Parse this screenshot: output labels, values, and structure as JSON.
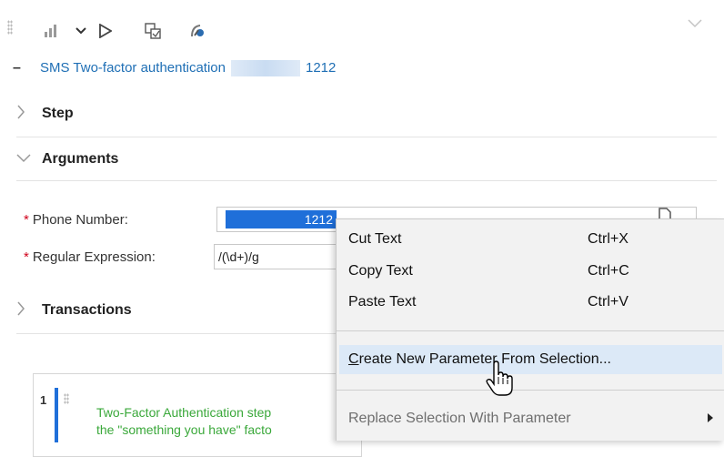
{
  "toolbar": {
    "icons": [
      "bar-chart-icon",
      "chevron-down-icon",
      "play-icon",
      "compare-icon",
      "record-icon"
    ]
  },
  "step_title": {
    "prefix": "SMS Two-factor authentication",
    "suffix": "1212"
  },
  "sections": {
    "step": "Step",
    "arguments": "Arguments",
    "transactions": "Transactions"
  },
  "fields": {
    "phone_label": "Phone Number:",
    "phone_value": "1212",
    "regex_label": "Regular Expression:",
    "regex_value": "/(\\d+)/g",
    "required_marker": "*"
  },
  "code": {
    "line_number": "1",
    "line1": "Two-Factor Authentication step",
    "line2": "the \"something you have\" facto"
  },
  "context_menu": {
    "cut_label": "Cut Text",
    "cut_shortcut": "Ctrl+X",
    "copy_label": "Copy Text",
    "copy_shortcut": "Ctrl+C",
    "paste_label": "Paste Text",
    "paste_shortcut": "Ctrl+V",
    "create_param_label": "Create New Parameter From Selection...",
    "replace_label": "Replace Selection With Parameter"
  },
  "colors": {
    "link": "#1f6fb5",
    "selection": "#1f6fd9",
    "required": "#d0021b",
    "code_text": "#3aa83a",
    "menu_highlight": "#dce9f7"
  }
}
